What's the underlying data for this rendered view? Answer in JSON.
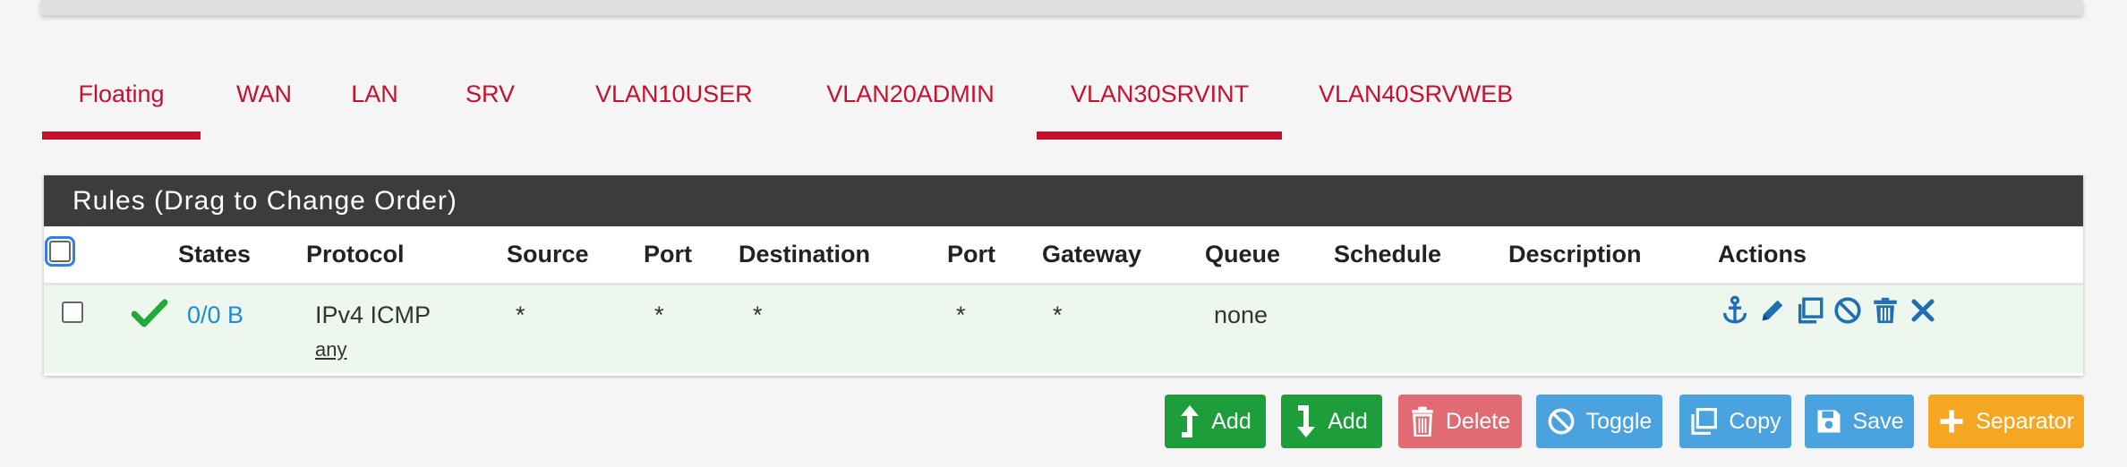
{
  "tabs": [
    {
      "label": "Floating",
      "active": true
    },
    {
      "label": "WAN",
      "active": false
    },
    {
      "label": "LAN",
      "active": false
    },
    {
      "label": "SRV",
      "active": false
    },
    {
      "label": "VLAN10USER",
      "active": false
    },
    {
      "label": "VLAN20ADMIN",
      "active": false
    },
    {
      "label": "VLAN30SRVINT",
      "active": true
    },
    {
      "label": "VLAN40SRVWEB",
      "active": false
    }
  ],
  "panel": {
    "title": "Rules (Drag to Change Order)",
    "columns": [
      "States",
      "Protocol",
      "Source",
      "Port",
      "Destination",
      "Port",
      "Gateway",
      "Queue",
      "Schedule",
      "Description",
      "Actions"
    ]
  },
  "rule": {
    "states": "0/0 B",
    "protocol": "IPv4 ICMP",
    "protocol_sub": "any",
    "source": "*",
    "source_port": "*",
    "destination": "*",
    "destination_port": "*",
    "gateway": "*",
    "queue": "none",
    "schedule": "",
    "description": ""
  },
  "buttons": {
    "add_top": "Add",
    "add_bottom": "Add",
    "delete": "Delete",
    "toggle": "Toggle",
    "copy": "Copy",
    "save": "Save",
    "separator": "Separator"
  },
  "colors": {
    "accent_red": "#c8102e",
    "green": "#1e9e3b",
    "danger": "#e06b73",
    "info": "#4aa3df",
    "warning": "#f5a623",
    "header_dark": "#3c3c3c"
  },
  "icons": [
    "anchor-icon",
    "pencil-icon",
    "copy-icon",
    "ban-icon",
    "trash-icon",
    "x-icon",
    "check-icon"
  ]
}
